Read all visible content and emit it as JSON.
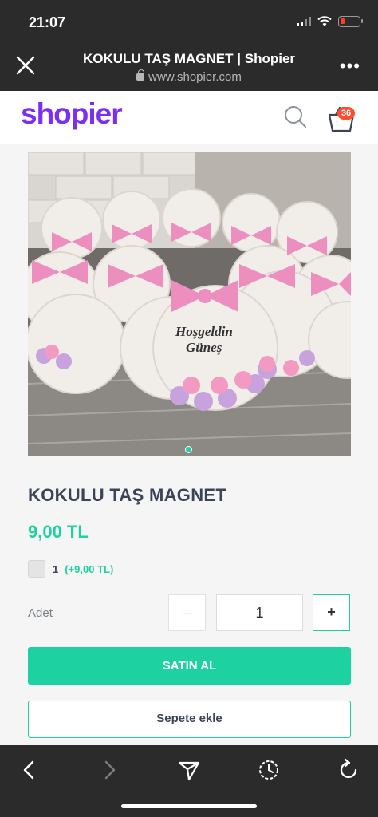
{
  "status_bar": {
    "time": "21:07"
  },
  "browser": {
    "title": "KOKULU TAŞ MAGNET | Shopier",
    "url": "www.shopier.com"
  },
  "site": {
    "logo": "shopier",
    "cart_count": "36"
  },
  "product": {
    "image_text_1": "Hoşgeldin",
    "image_text_2": "Güneş",
    "title": "KOKULU TAŞ MAGNET",
    "price": "9,00 TL",
    "option": {
      "name": "1",
      "price": "(+9,00 TL)"
    },
    "quantity_label": "Adet",
    "quantity_value": "1",
    "minus_label": "–",
    "plus_label": "+",
    "buy_label": "SATIN AL",
    "add_to_cart_label": "Sepete ekle"
  },
  "colors": {
    "accent": "#1dd1a1",
    "brand": "#7b2ff2",
    "badge": "#ff4d2d"
  },
  "icons": [
    "close-icon",
    "more-icon",
    "search-icon",
    "cart-icon",
    "back-icon",
    "forward-icon",
    "share-icon",
    "history-icon",
    "reload-icon"
  ]
}
